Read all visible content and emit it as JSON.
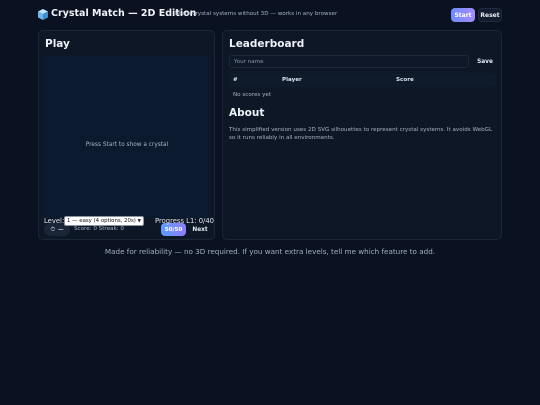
{
  "header": {
    "icon": "ice-cube-icon",
    "title": "Crystal Match — 2D Edition",
    "subtitle": "Learn crystal systems without 3D — works in any browser",
    "start_label": "Start",
    "reset_label": "Reset",
    "accent": "#8a8cff"
  },
  "play": {
    "title": "Play",
    "canvas_message": "Press Start to show a crystal",
    "timer_icon": "stopwatch-icon",
    "timer_value": "—",
    "score_text": "Score: 0  Streak: 0",
    "fifty_label": "50/50",
    "next_label": "Next",
    "level_label": "Level:",
    "level_selected": "1 — easy (4 options, 20s)",
    "progress_text": "Progress L1: 0/40"
  },
  "leaderboard": {
    "title": "Leaderboard",
    "name_placeholder": "Your name",
    "save_label": "Save",
    "columns": [
      "#",
      "Player",
      "Score"
    ],
    "empty_text": "No scores yet"
  },
  "about": {
    "title": "About",
    "text": "This simplified version uses 2D SVG silhouettes to represent crystal systems. It avoids WebGL so it runs reliably in all environments."
  },
  "footer": {
    "text": "Made for reliability — no 3D required. If you want extra levels, tell me which feature to add."
  }
}
